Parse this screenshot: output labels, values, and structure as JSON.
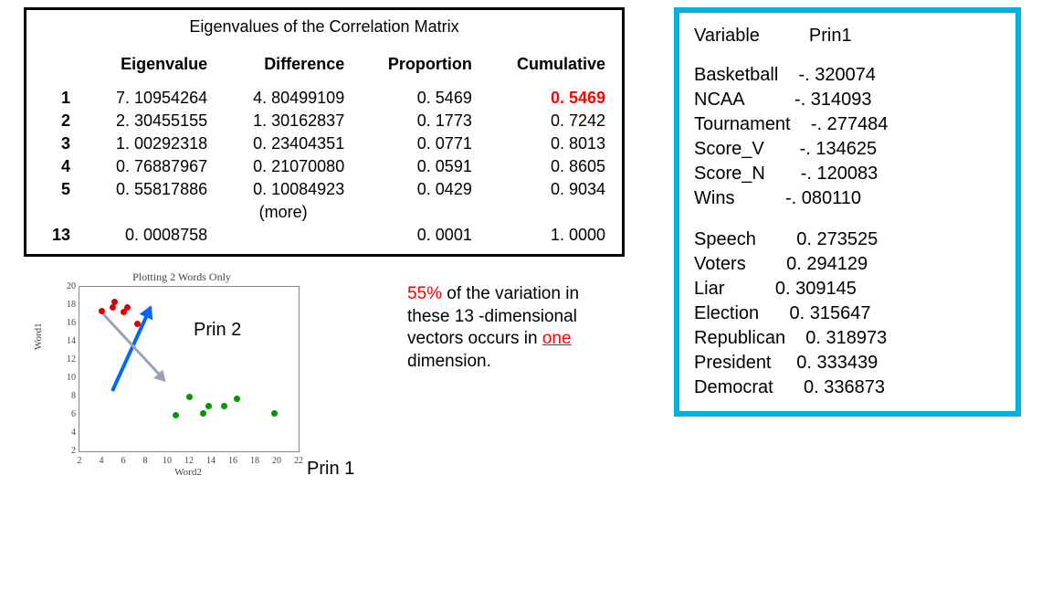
{
  "eigen_box": {
    "title": "Eigenvalues of the Correlation Matrix",
    "headers": [
      "",
      "Eigenvalue",
      "Difference",
      "Proportion",
      "Cumulative"
    ],
    "rows": [
      {
        "n": "1",
        "eig": "7. 10954264",
        "diff": "4. 80499109",
        "prop": "0. 5469",
        "cum": "0. 5469",
        "cum_hl": true
      },
      {
        "n": "2",
        "eig": "2. 30455155",
        "diff": "1. 30162837",
        "prop": "0. 1773",
        "cum": "0. 7242"
      },
      {
        "n": "3",
        "eig": "1. 00292318",
        "diff": "0. 23404351",
        "prop": "0. 0771",
        "cum": "0. 8013"
      },
      {
        "n": "4",
        "eig": "0. 76887967",
        "diff": "0. 21070080",
        "prop": "0. 0591",
        "cum": "0. 8605"
      },
      {
        "n": "5",
        "eig": "0. 55817886",
        "diff": "0. 10084923",
        "prop": "0. 0429",
        "cum": "0. 9034"
      }
    ],
    "more": "(more)",
    "last": {
      "n": "13",
      "eig": "0. 0008758",
      "diff": "",
      "prop": "0. 0001",
      "cum": "1. 0000"
    }
  },
  "right": {
    "head_var": "Variable",
    "head_prin": "Prin1",
    "group_neg": [
      [
        "Basketball",
        "-. 320074"
      ],
      [
        "NCAA",
        "-. 314093"
      ],
      [
        "Tournament",
        "-. 277484"
      ],
      [
        "Score_V",
        "-. 134625"
      ],
      [
        "Score_N",
        "-. 120083"
      ],
      [
        "Wins",
        "-. 080110"
      ]
    ],
    "group_pos": [
      [
        "Speech",
        "0. 273525"
      ],
      [
        "Voters",
        "0. 294129"
      ],
      [
        "Liar",
        "0. 309145"
      ],
      [
        "Election",
        "0. 315647"
      ],
      [
        "Republican",
        "0. 318973"
      ],
      [
        "President",
        "0. 333439"
      ],
      [
        "Democrat",
        "0. 336873"
      ]
    ]
  },
  "caption": {
    "pct": "55%",
    "rest1": " of the variation in these 13 -dimensional vectors occurs in ",
    "one": "one",
    "rest2": " dimension."
  },
  "labels": {
    "prin2": "Prin 2",
    "prin1": "Prin 1"
  },
  "chart_data": {
    "type": "scatter",
    "title": "Plotting 2 Words Only",
    "xlabel": "Word2",
    "ylabel": "Word1",
    "xlim": [
      2,
      22
    ],
    "ylim": [
      2,
      20
    ],
    "xticks": [
      2,
      4,
      6,
      8,
      10,
      12,
      14,
      16,
      18,
      20,
      22
    ],
    "yticks": [
      2,
      4,
      6,
      8,
      10,
      12,
      14,
      16,
      18,
      20
    ],
    "series": [
      {
        "name": "red",
        "points": [
          [
            4.0,
            17.4
          ],
          [
            5.0,
            17.8
          ],
          [
            5.2,
            18.4
          ],
          [
            6.0,
            17.3
          ],
          [
            6.4,
            17.8
          ],
          [
            7.3,
            16.0
          ]
        ]
      },
      {
        "name": "green",
        "points": [
          [
            10.8,
            6.0
          ],
          [
            12.0,
            8.0
          ],
          [
            13.3,
            6.2
          ],
          [
            13.8,
            7.0
          ],
          [
            15.2,
            7.0
          ],
          [
            16.4,
            7.8
          ],
          [
            19.8,
            6.2
          ]
        ]
      }
    ],
    "arrows": [
      {
        "name": "Prin 2 axis (blue)",
        "from": [
          5.0,
          8.6
        ],
        "to": [
          8.5,
          17.8
        ]
      },
      {
        "name": "Prin 1 axis (gray)",
        "from": [
          4.0,
          17.2
        ],
        "to": [
          9.8,
          9.7
        ]
      }
    ]
  }
}
